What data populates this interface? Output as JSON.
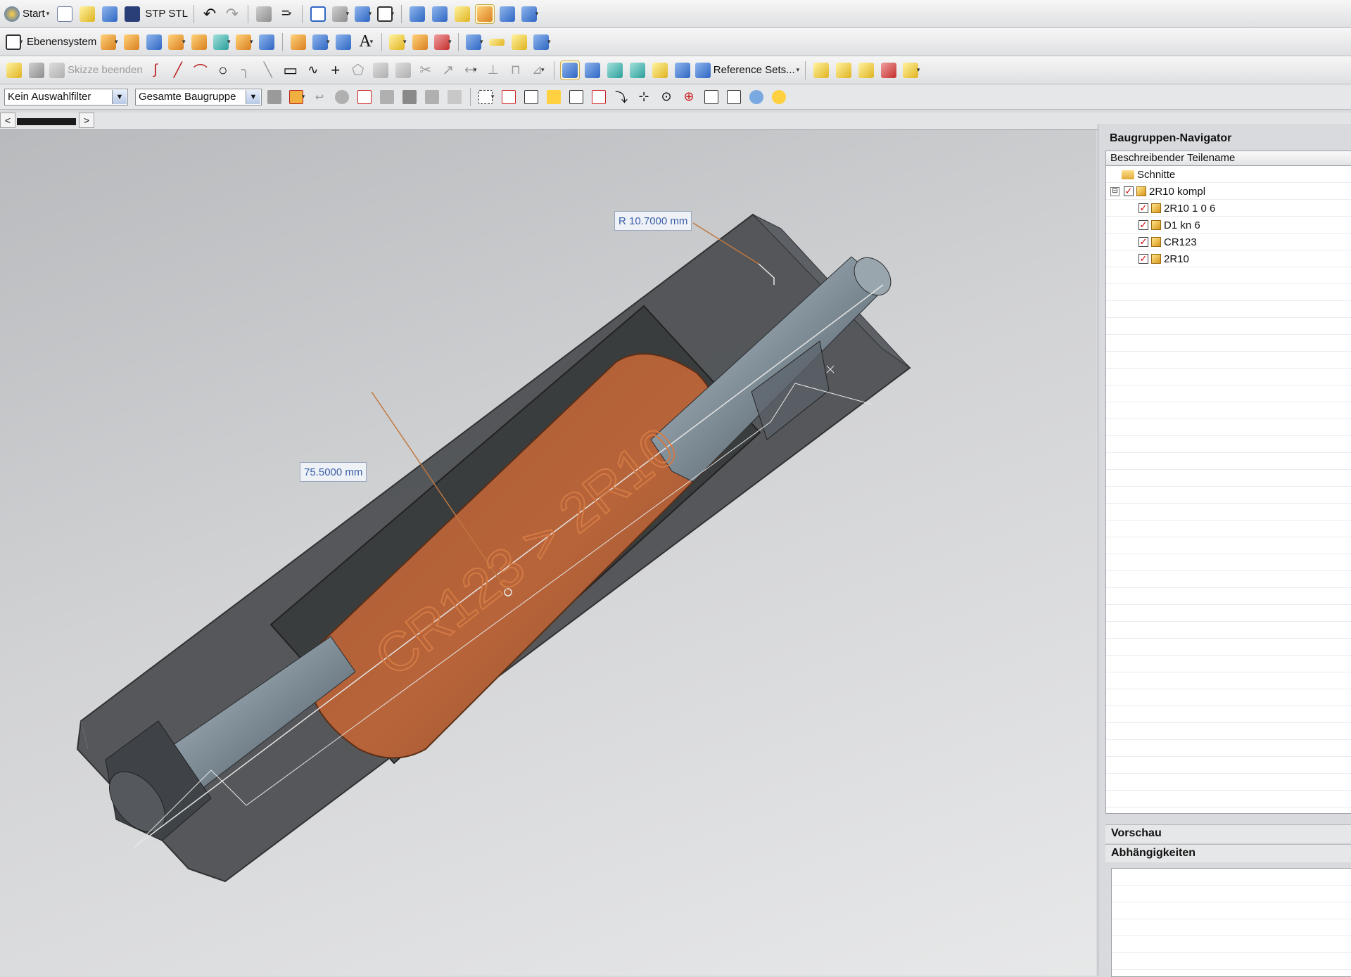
{
  "toolbar1": {
    "start_label": "Start",
    "stp_label": "STP",
    "stl_label": "STL"
  },
  "toolbar2": {
    "layer_label": "Ebenensystem",
    "text_tool_label": "A"
  },
  "toolbar3": {
    "finish_sketch_label": "Skizze beenden",
    "reference_sets_label": "Reference Sets..."
  },
  "selection_bar": {
    "filter_value": "Kein Auswahlfilter",
    "scope_value": "Gesamte Baugruppe"
  },
  "tabstrip": {
    "left_arrow": "<",
    "right_arrow": ">"
  },
  "viewport": {
    "dim_radius": "R 10.7000 mm",
    "dim_length": "75.5000 mm",
    "engraved_text": "CR123 > 2R10",
    "colors": {
      "housing": "#4a4c4f",
      "battery": "#b8643a",
      "shaft": "#7e8c96"
    }
  },
  "navigator": {
    "title": "Baugruppen-Navigator",
    "column_header": "Beschreibender Teilename",
    "tree": [
      {
        "label": "Schnitte",
        "icon": "folder-icon",
        "checked": false
      },
      {
        "label": "2R10 kompl",
        "icon": "assembly-icon",
        "checked": true,
        "expand": "⊟"
      },
      {
        "label": "2R10 1 0 6",
        "icon": "part-icon",
        "checked": true
      },
      {
        "label": "D1 kn 6",
        "icon": "part-icon",
        "checked": true
      },
      {
        "label": "CR123",
        "icon": "part-icon",
        "checked": true
      },
      {
        "label": "2R10",
        "icon": "part-icon",
        "checked": true
      }
    ],
    "preview_label": "Vorschau",
    "dependencies_label": "Abhängigkeiten"
  }
}
